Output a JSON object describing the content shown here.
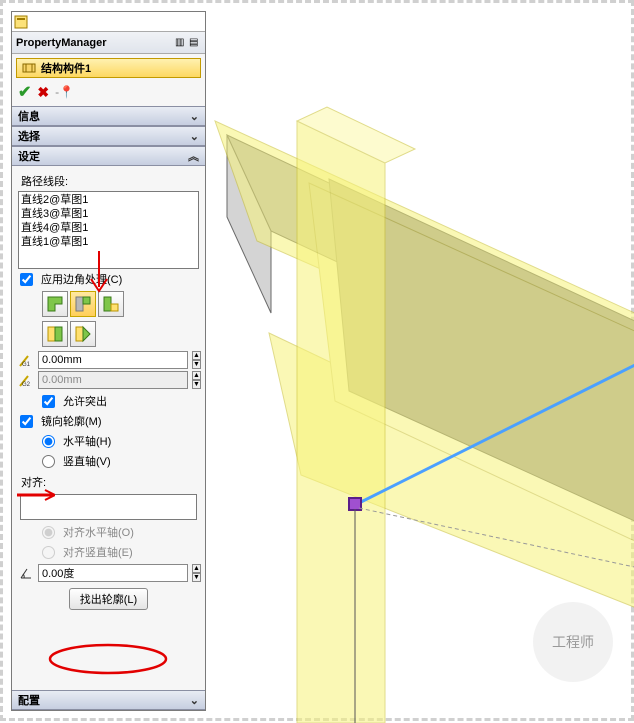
{
  "pm": {
    "title": "PropertyManager"
  },
  "feature": {
    "name": "结构构件1"
  },
  "sections": {
    "info": "信息",
    "select": "选择",
    "settings": "设定",
    "config": "配置"
  },
  "settings": {
    "path_label": "路径线段:",
    "path_items": [
      "直线2@草图1",
      "直线3@草图1",
      "直线4@草图1",
      "直线1@草图1"
    ],
    "apply_corner": "应用边角处理(C)",
    "g1_value": "0.00mm",
    "g2_value": "0.00mm",
    "allow_protrude": "允许突出",
    "mirror_profile": "镜向轮廓(M)",
    "axis_h": "水平轴(H)",
    "axis_v": "竖直轴(V)",
    "align_label": "对齐:",
    "align_h": "对齐水平轴(O)",
    "align_v": "对齐竖直轴(E)",
    "angle_value": "0.00度",
    "find_profile": "找出轮廓(L)"
  },
  "watermark": "工程师"
}
